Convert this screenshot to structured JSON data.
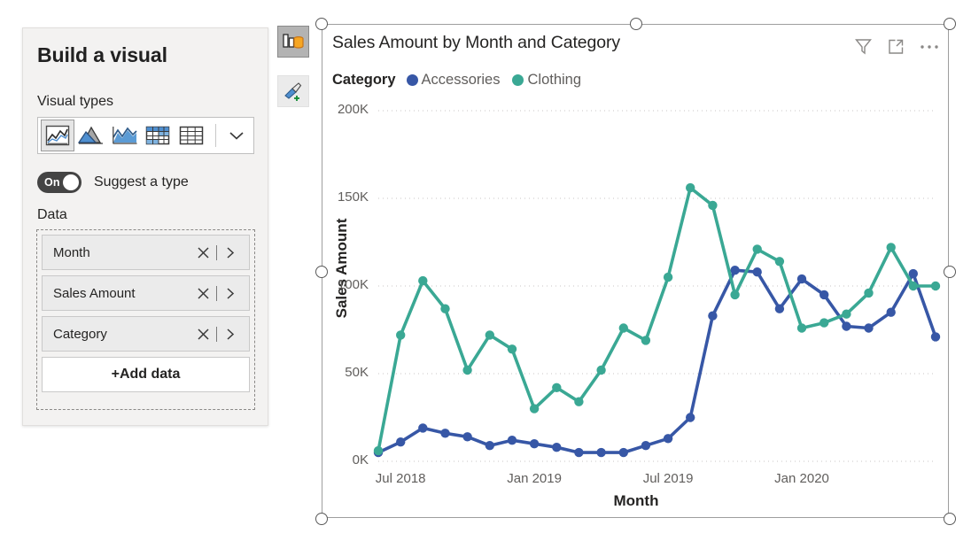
{
  "pane": {
    "title": "Build a visual",
    "visual_types_label": "Visual types",
    "data_label": "Data",
    "suggest_toggle": {
      "state_text": "On",
      "label": "Suggest a type",
      "enabled": true
    },
    "visual_type_options": [
      {
        "name": "line-chart",
        "selected": true
      },
      {
        "name": "area-chart",
        "selected": false
      },
      {
        "name": "line-and-area-chart",
        "selected": false
      },
      {
        "name": "matrix",
        "selected": false
      },
      {
        "name": "table",
        "selected": false
      }
    ],
    "more_types_icon": "chevron-down-icon",
    "fields": [
      {
        "label": "Month",
        "remove_icon": "close-icon",
        "expand_icon": "chevron-right-icon"
      },
      {
        "label": "Sales Amount",
        "remove_icon": "close-icon",
        "expand_icon": "chevron-right-icon"
      },
      {
        "label": "Category",
        "remove_icon": "close-icon",
        "expand_icon": "chevron-right-icon"
      }
    ],
    "add_data_label": "+Add data"
  },
  "rail": {
    "build_icon": "build-visual-icon",
    "format_icon": "format-paintbrush-icon"
  },
  "visual": {
    "title": "Sales Amount by Month and Category",
    "actions": [
      {
        "name": "filter-icon",
        "label": "Filters"
      },
      {
        "name": "focus-mode-icon",
        "label": "Focus mode"
      },
      {
        "name": "more-options-icon",
        "label": "More options"
      }
    ]
  },
  "colors": {
    "accessories": "#3757a6",
    "clothing": "#3aa894",
    "gridline": "#c8c6c4",
    "axis_text": "#605e5c",
    "title_text": "#252423",
    "pane_bg": "#f3f2f1"
  },
  "chart_data": {
    "type": "line",
    "title": "Sales Amount by Month and Category",
    "xlabel": "Month",
    "ylabel": "Sales Amount",
    "legend_title": "Category",
    "legend_position": "top",
    "grid": true,
    "ylim": [
      0,
      200000
    ],
    "ytick_labels": [
      "0K",
      "50K",
      "100K",
      "150K",
      "200K"
    ],
    "ytick_values": [
      0,
      50000,
      100000,
      150000,
      200000
    ],
    "xtick_labels": [
      "Jul 2018",
      "Jan 2019",
      "Jul 2019",
      "Jan 2020"
    ],
    "xtick_indices": [
      1,
      7,
      13,
      19
    ],
    "x": [
      "Jun 2018",
      "Jul 2018",
      "Aug 2018",
      "Sep 2018",
      "Oct 2018",
      "Nov 2018",
      "Dec 2018",
      "Jan 2019",
      "Feb 2019",
      "Mar 2019",
      "Apr 2019",
      "May 2019",
      "Jun 2019",
      "Jul 2019",
      "Aug 2019",
      "Sep 2019",
      "Oct 2019",
      "Nov 2019",
      "Dec 2019",
      "Jan 2020",
      "Feb 2020",
      "Mar 2020",
      "Apr 2020",
      "May 2020",
      "Jun 2020"
    ],
    "series": [
      {
        "name": "Accessories",
        "color": "#3757a6",
        "values": [
          5000,
          11000,
          19000,
          16000,
          14000,
          9000,
          12000,
          10000,
          8000,
          5000,
          5000,
          5000,
          9000,
          13000,
          25000,
          83000,
          109000,
          108000,
          87000,
          104000,
          95000,
          77000,
          76000,
          85000,
          107000
        ]
      },
      {
        "name": "Clothing",
        "color": "#3aa894",
        "values": [
          6000,
          72000,
          103000,
          87000,
          52000,
          72000,
          64000,
          30000,
          42000,
          34000,
          52000,
          76000,
          69000,
          105000,
          156000,
          146000,
          95000,
          121000,
          114000,
          76000,
          79000,
          84000,
          96000,
          122000,
          100000
        ]
      }
    ],
    "extra_points": [
      {
        "series": "Accessories",
        "x": "Jul 2020",
        "value": 71000
      },
      {
        "series": "Clothing",
        "x": "Jul 2020",
        "value": 100000
      }
    ]
  }
}
